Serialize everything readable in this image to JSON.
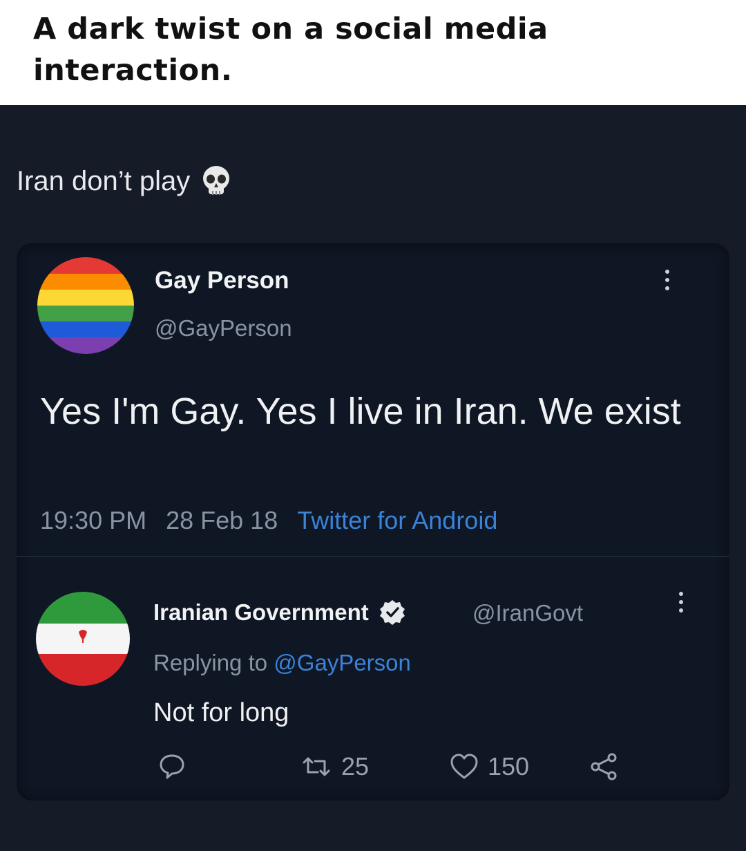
{
  "header": {
    "title": "A dark twist on a social media interaction."
  },
  "post": {
    "text": "Iran don’t play",
    "emoji_icon": "skull-icon"
  },
  "tweet": {
    "name": "Gay Person",
    "handle": "@GayPerson",
    "avatar_icon": "rainbow-flag-avatar",
    "text": "Yes I'm Gay. Yes I live in Iran. We exist",
    "time": "19:30 PM",
    "date": "28 Feb 18",
    "source": "Twitter for Android"
  },
  "reply": {
    "name": "Iranian Government",
    "handle": "@IranGovt",
    "avatar_icon": "iran-flag-avatar",
    "verified_icon": "verified-badge-icon",
    "replying_prefix": "Replying to",
    "replying_to": "@GayPerson",
    "text": "Not for long",
    "retweets": "25",
    "likes": "150"
  },
  "colors": {
    "background": "#151b27",
    "card": "#0f1624",
    "link": "#3b82d8",
    "muted": "#8a93a3"
  }
}
